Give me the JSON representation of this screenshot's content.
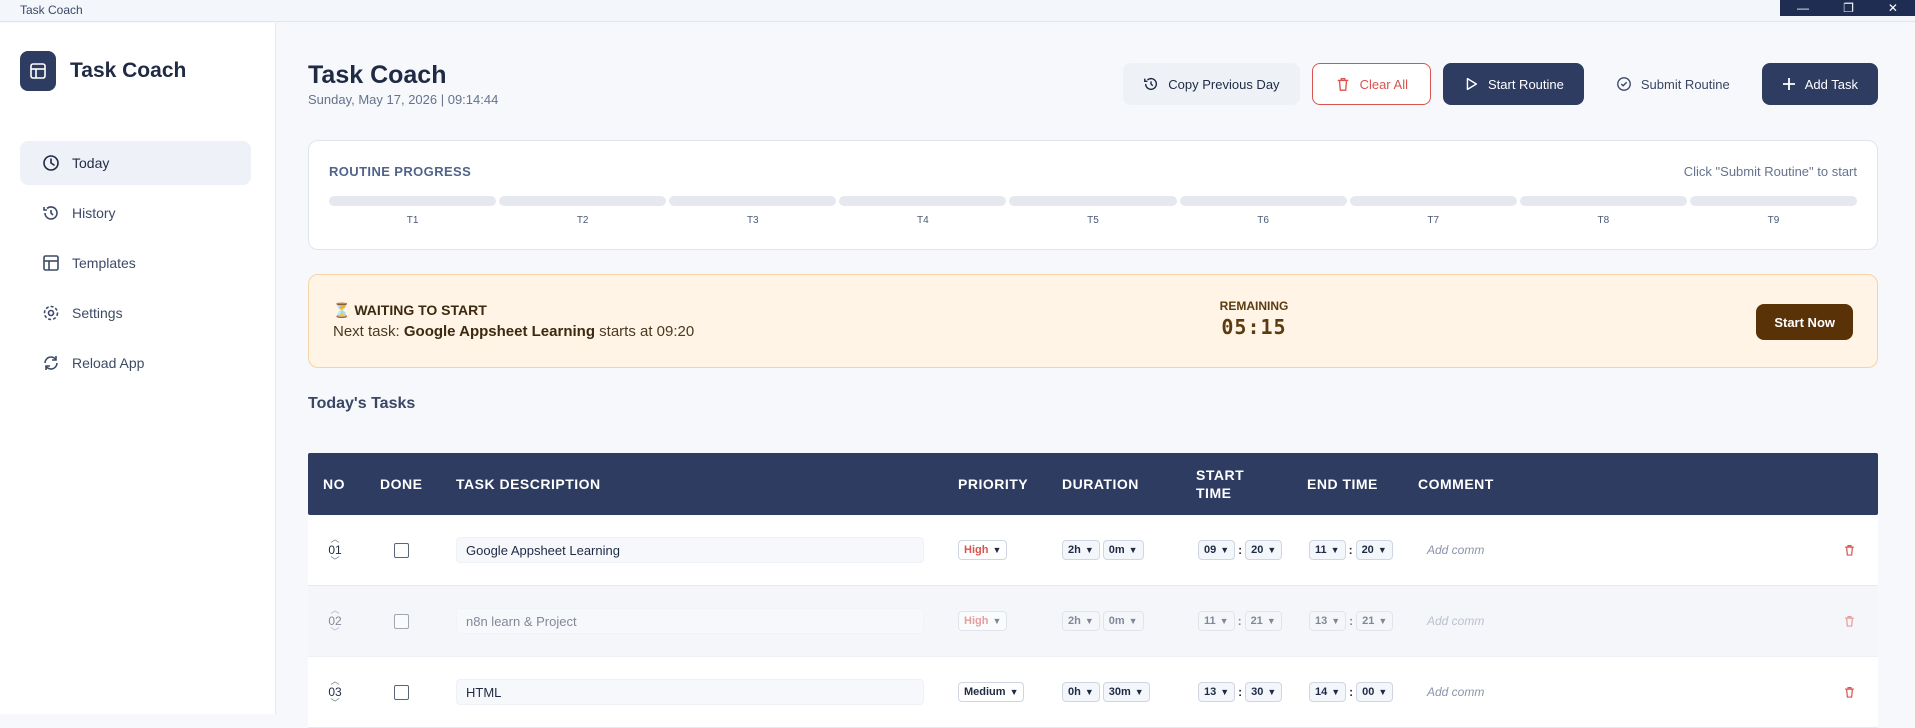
{
  "window": {
    "title": "Task Coach",
    "controls": [
      "—",
      "❐",
      "✕"
    ]
  },
  "sidebar": {
    "brand": "Task Coach",
    "items": [
      {
        "label": "Today",
        "icon": "clock-icon",
        "active": true
      },
      {
        "label": "History",
        "icon": "history-icon",
        "active": false
      },
      {
        "label": "Templates",
        "icon": "templates-icon",
        "active": false
      },
      {
        "label": "Settings",
        "icon": "gear-icon",
        "active": false
      },
      {
        "label": "Reload App",
        "icon": "reload-icon",
        "active": false
      }
    ]
  },
  "header": {
    "title": "Task Coach",
    "subtitle": "Sunday, May 17, 2026 | 09:14:44",
    "buttons": {
      "copy_prev": "Copy Previous Day",
      "clear_all": "Clear All",
      "start_routine": "Start Routine",
      "submit_routine": "Submit Routine",
      "add_task": "Add Task"
    }
  },
  "progress": {
    "label": "ROUTINE PROGRESS",
    "hint": "Click \"Submit Routine\" to start",
    "segments": [
      "T1",
      "T2",
      "T3",
      "T4",
      "T5",
      "T6",
      "T7",
      "T8",
      "T9"
    ]
  },
  "waiting": {
    "title": "⏳ WAITING TO START",
    "next_prefix": "Next task: ",
    "next_task": "Google Appsheet Learning",
    "next_suffix": " starts at 09:20",
    "remaining_label": "REMAINING",
    "remaining_time": "05:15",
    "start_now": "Start Now"
  },
  "tasks_section": {
    "title": "Today's Tasks"
  },
  "table": {
    "headers": {
      "no": "NO",
      "done": "DONE",
      "desc": "TASK DESCRIPTION",
      "priority": "PRIORITY",
      "duration": "DURATION",
      "start_1": "START",
      "start_2": "TIME",
      "end": "END TIME",
      "comment": "COMMENT"
    },
    "rows": [
      {
        "no": "01",
        "desc": "Google Appsheet Learning",
        "priority": "High",
        "dur_h": "2h",
        "dur_m": "0m",
        "start_h": "09",
        "start_m": "20",
        "end_h": "11",
        "end_m": "20",
        "comment_placeholder": "Add comm"
      },
      {
        "no": "02",
        "desc": "n8n learn & Project",
        "priority": "High",
        "dur_h": "2h",
        "dur_m": "0m",
        "start_h": "11",
        "start_m": "21",
        "end_h": "13",
        "end_m": "21",
        "comment_placeholder": "Add comm"
      },
      {
        "no": "03",
        "desc": "HTML",
        "priority": "Medium",
        "dur_h": "0h",
        "dur_m": "30m",
        "start_h": "13",
        "start_m": "30",
        "end_h": "14",
        "end_m": "00",
        "comment_placeholder": "Add comm"
      }
    ]
  },
  "colors": {
    "primary": "#2e3c62",
    "danger": "#d9534f",
    "warning_bg": "#fff4e6",
    "start_now": "#5a3207"
  }
}
